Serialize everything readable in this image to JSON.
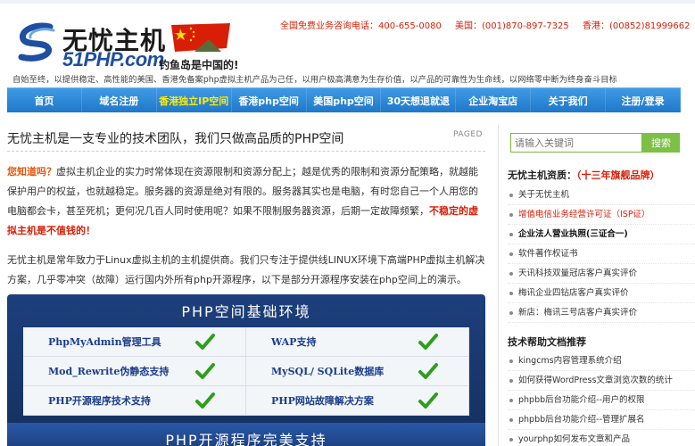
{
  "logo": {
    "cn": "无忧主机",
    "en": "51PHP.com",
    "slogan": "钓鱼岛是中国的!"
  },
  "hotline": {
    "cn": "全国免费业务咨询电话：400-655-0080",
    "us": "美国：(001)870-897-7325",
    "hk": "香港：(00852)81999662"
  },
  "tagline": "自始至终，以提供稳定、高性能的美国、香港免备案php虚拟主机产品为己任，以用户极高满意为生存价值，以产品的可靠性为生命线，以网络零中断为终身奋斗目标",
  "nav": {
    "items": [
      {
        "label": "首页"
      },
      {
        "label": "域名注册"
      },
      {
        "label": "香港独立IP空间"
      },
      {
        "label": "香港php空间"
      },
      {
        "label": "美国php空间"
      },
      {
        "label": "30天想退就退"
      },
      {
        "label": "企业淘宝店"
      },
      {
        "label": "关于我们"
      },
      {
        "label": "注册/登录"
      }
    ]
  },
  "article": {
    "title": "无忧主机是一支专业的技术团队，我们只做高品质的PHP空间",
    "status": "PAGED",
    "p1_lead": "您知道吗？",
    "p1_body": "虚拟主机企业的实力时常体现在资源限制和资源分配上；越是优秀的限制和资源分配策略，就越能保护用户的权益，也就越稳定。服务器的资源是绝对有限的。服务器其实也是电脑，有时您自己一个人用您的电脑都会卡，甚至死机；更何况几百人同时使用呢？如果不限制服务器资源，后期一定故障频繁，",
    "p1_tail": "不稳定的虚拟主机是不值钱的！",
    "p2": "无忧主机是常年致力于Linux虚拟主机的主机提供商。我们只专注于提供线LINUX环境下高端PHP虚拟主机解决方案，几乎零冲突（故障）运行国内外所有php开源程序，以下是部分开源程序安装在php空间上的演示。"
  },
  "env_board": {
    "title": "PHP空间基础环境",
    "features": [
      {
        "label": "PhpMyAdmin管理工具"
      },
      {
        "label": "WAP支持"
      },
      {
        "label": "Mod_Rewrite伪静态支持"
      },
      {
        "label": "MySQL/ SQLite数据库"
      },
      {
        "label": "PHP开源程序技术支持"
      },
      {
        "label": "PHP网站故障解决方案"
      }
    ]
  },
  "open_board": {
    "title": "PHP开源程序完美支持"
  },
  "sidebar": {
    "search": {
      "placeholder": "请输入关键词",
      "button": "搜索"
    },
    "quals_title": "无忧主机资质：",
    "quals_highlight": "（十三年旗舰品牌）",
    "quals": [
      {
        "label": "关于无忧主机",
        "style": ""
      },
      {
        "label": "增值电信业务经营许可证（ISP证）",
        "style": "hl"
      },
      {
        "label": "企业法人营业执照(三证合一)",
        "style": "b"
      },
      {
        "label": "软件著作权证书",
        "style": ""
      },
      {
        "label": "天讯科技双量冠店客户真实评价",
        "style": ""
      },
      {
        "label": "梅讯企业四钻店客户真实评价",
        "style": ""
      },
      {
        "label": "新店：梅讯三号店客户真实评价",
        "style": ""
      }
    ],
    "docs_title": "技术帮助文档推荐",
    "docs": [
      {
        "label": "kingcms内容管理系统介绍"
      },
      {
        "label": "如何获得WordPress文章浏览次数的统计"
      },
      {
        "label": "phpbb后台功能介绍--用户的权限"
      },
      {
        "label": "phpbb后台功能介绍--管理扩展名"
      },
      {
        "label": "yourphp如何发布文章和产品"
      }
    ]
  },
  "colors": {
    "accent_red": "#d81e06",
    "nav_blue": "#2a86d8",
    "board_blue": "#1d3f7c",
    "check_green": "#2e9e1c",
    "search_green": "#7cc045"
  }
}
